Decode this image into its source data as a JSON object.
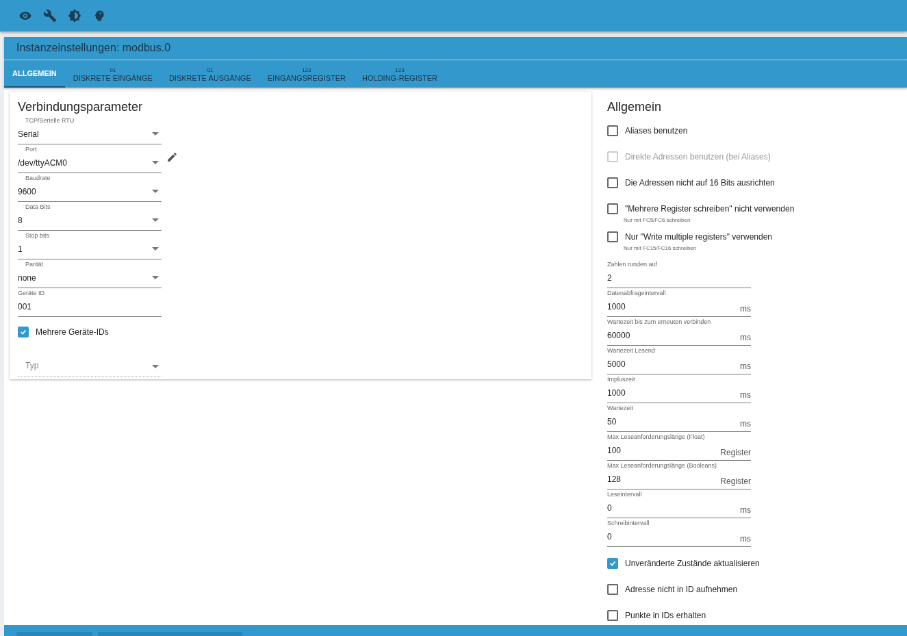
{
  "toolbar": {
    "icons": [
      {
        "kind": "eye"
      },
      {
        "kind": "wrench"
      },
      {
        "kind": "contrast"
      },
      {
        "kind": "head"
      }
    ]
  },
  "header": {
    "title": "Instanzeinstellungen: modbus.0"
  },
  "tabs": [
    {
      "label": "ALLGEMEIN",
      "selected": true
    },
    {
      "label": "DISKRETE EINGÄNGE",
      "badge": "01",
      "selected": false
    },
    {
      "label": "DISKRETE AUSGÄNGE",
      "badge": "01",
      "selected": false
    },
    {
      "label": "EINGANGSREGISTER",
      "badge": "123",
      "selected": false
    },
    {
      "label": "HOLDING-REGISTER",
      "badge": "123",
      "selected": false
    }
  ],
  "connection": {
    "title": "Verbindungsparameter",
    "fields": [
      {
        "kind": "select",
        "label": "TCP/Serielle RTU",
        "value": "Serial"
      },
      {
        "kind": "select",
        "label": "Port",
        "value": "/dev/ttyACM0",
        "edit": true
      },
      {
        "kind": "select",
        "label": "Baudrate",
        "value": "9600"
      },
      {
        "kind": "select",
        "label": "Data Bits",
        "value": "8"
      },
      {
        "kind": "select",
        "label": "Stop bits",
        "value": "1"
      },
      {
        "kind": "select",
        "label": "Parität",
        "value": "none"
      },
      {
        "kind": "input",
        "label": "Geräte ID",
        "value": "001"
      },
      {
        "kind": "checkbox",
        "label": "Mehrere Geräte-IDs",
        "checked": true
      },
      {
        "kind": "placeholder-select",
        "placeholder": "Typ",
        "disabled": true
      }
    ]
  },
  "general": {
    "title": "Allgemein",
    "items": [
      {
        "kind": "checkbox",
        "label": "Aliases benutzen",
        "checked": false,
        "disabled": false
      },
      {
        "kind": "checkbox",
        "label": "Direkte Adressen benutzen (bei Aliases)",
        "checked": false,
        "disabled": true
      },
      {
        "kind": "checkbox",
        "label": "Die Adressen nicht auf 16 Bits ausrichten",
        "checked": false,
        "disabled": false
      },
      {
        "kind": "checkbox",
        "label": "\"Mehrere Register schreiben\" nicht verwenden",
        "hint": "Nur mit FC5/FC6 schreiben",
        "checked": false,
        "disabled": false
      },
      {
        "kind": "checkbox",
        "label": "Nur \"Write multiple registers\" verwenden",
        "hint": "Nur mit FC15/FC16 schreiben",
        "checked": false,
        "disabled": false
      },
      {
        "kind": "input",
        "label": "Zahlen runden auf",
        "value": "2"
      },
      {
        "kind": "input",
        "label": "Datenabfrageintervall",
        "value": "1000",
        "unit": "ms"
      },
      {
        "kind": "input",
        "label": "Wartezeit bis zum erneuten verbinden",
        "value": "60000",
        "unit": "ms"
      },
      {
        "kind": "input",
        "label": "Wartezeit Lesend",
        "value": "5000",
        "unit": "ms"
      },
      {
        "kind": "input",
        "label": "Impluszeit",
        "value": "1000",
        "unit": "ms"
      },
      {
        "kind": "input",
        "label": "Wartezeit",
        "value": "50",
        "unit": "ms"
      },
      {
        "kind": "input",
        "label": "Max Leseanforderungslänge (Float)",
        "value": "100",
        "unit": "Register"
      },
      {
        "kind": "input",
        "label": "Max Leseanforderungslänge (Booleans)",
        "value": "128",
        "unit": "Register"
      },
      {
        "kind": "input",
        "label": "Leseintervall",
        "value": "0",
        "unit": "ms"
      },
      {
        "kind": "input",
        "label": "Schreibintervall",
        "value": "0",
        "unit": "ms"
      },
      {
        "kind": "checkbox",
        "label": "Unveränderte Zustände aktualisieren",
        "checked": true,
        "disabled": false
      },
      {
        "kind": "checkbox",
        "label": "Adresse nicht in ID aufnehmen",
        "checked": false,
        "disabled": false
      },
      {
        "kind": "checkbox",
        "label": "Punkte in IDs erhalten",
        "checked": false,
        "disabled": false
      }
    ]
  },
  "footer": {
    "buttons": [
      {
        "kind": "short"
      },
      {
        "kind": "long"
      }
    ]
  }
}
